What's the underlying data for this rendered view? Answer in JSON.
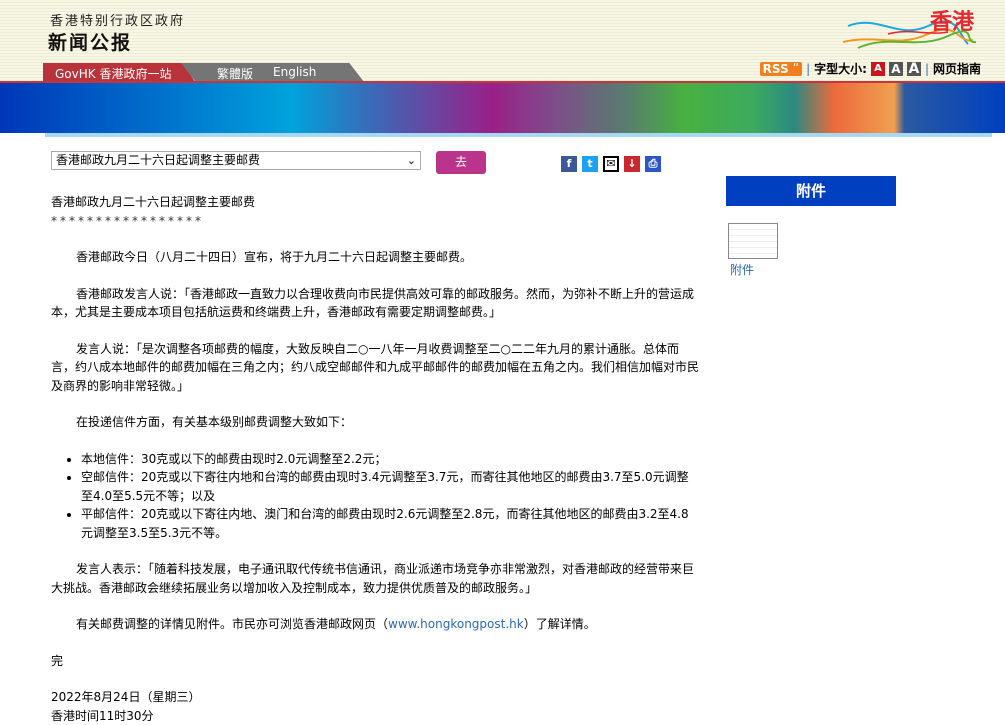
{
  "header": {
    "gov_name": "香港特别行政区政府",
    "site_title": "新闻公报",
    "logo_text": "香港"
  },
  "nav": {
    "govhk": "GovHK 香港政府一站通",
    "traditional": "繁體版",
    "english": "English"
  },
  "tools": {
    "rss": "RSS",
    "font_size_label": "字型大小:",
    "font_a": "A",
    "guide": "网页指南"
  },
  "select": {
    "value": "香港邮政九月二十六日起调整主要邮费",
    "go": "去"
  },
  "share": [
    "facebook",
    "twitter",
    "email",
    "download",
    "print"
  ],
  "article": {
    "title": "香港邮政九月二十六日起调整主要邮费",
    "stars": "*****************",
    "p1": "香港邮政今日（八月二十四日）宣布，将于九月二十六日起调整主要邮费。",
    "p2": "香港邮政发言人说：「香港邮政一直致力以合理收费向市民提供高效可靠的邮政服务。然而，为弥补不断上升的营运成本，尤其是主要成本项目包括航运费和终端费上升，香港邮政有需要定期调整邮费。」",
    "p3": "发言人说：「是次调整各项邮费的幅度，大致反映自二○一八年一月收费调整至二○二二年九月的累计通胀。总体而言，约八成本地邮件的邮费加幅在三角之内；约八成空邮邮件和九成平邮邮件的邮费加幅在五角之内。我们相信加幅对市民及商界的影响非常轻微。」",
    "p4": "在投递信件方面，有关基本级别邮费调整大致如下：",
    "bullets": [
      "本地信件：30克或以下的邮费由现时2.0元调整至2.2元；",
      "空邮信件：20克或以下寄往内地和台湾的邮费由现时3.4元调整至3.7元，而寄往其他地区的邮费由3.7至5.0元调整至4.0至5.5元不等；以及",
      "平邮信件：20克或以下寄往内地、澳门和台湾的邮费由现时2.6元调整至2.8元，而寄往其他地区的邮费由3.2至4.8元调整至3.5至5.3元不等。"
    ],
    "p5": "发言人表示：「随着科技发展，电子通讯取代传统书信通讯，商业派递市场竞争亦非常激烈，对香港邮政的经营带来巨大挑战。香港邮政会继续拓展业务以增加收入及控制成本，致力提供优质普及的邮政服务。」",
    "p6_pre": "有关邮费调整的详情见附件。市民亦可浏览香港邮政网页（",
    "p6_link": "www.hongkongpost.hk",
    "p6_post": "）了解详情。",
    "end": "完",
    "date": "2022年8月24日（星期三）",
    "time": "香港时间11时30分"
  },
  "sidebar": {
    "heading": "附件",
    "attachment": "附件"
  }
}
